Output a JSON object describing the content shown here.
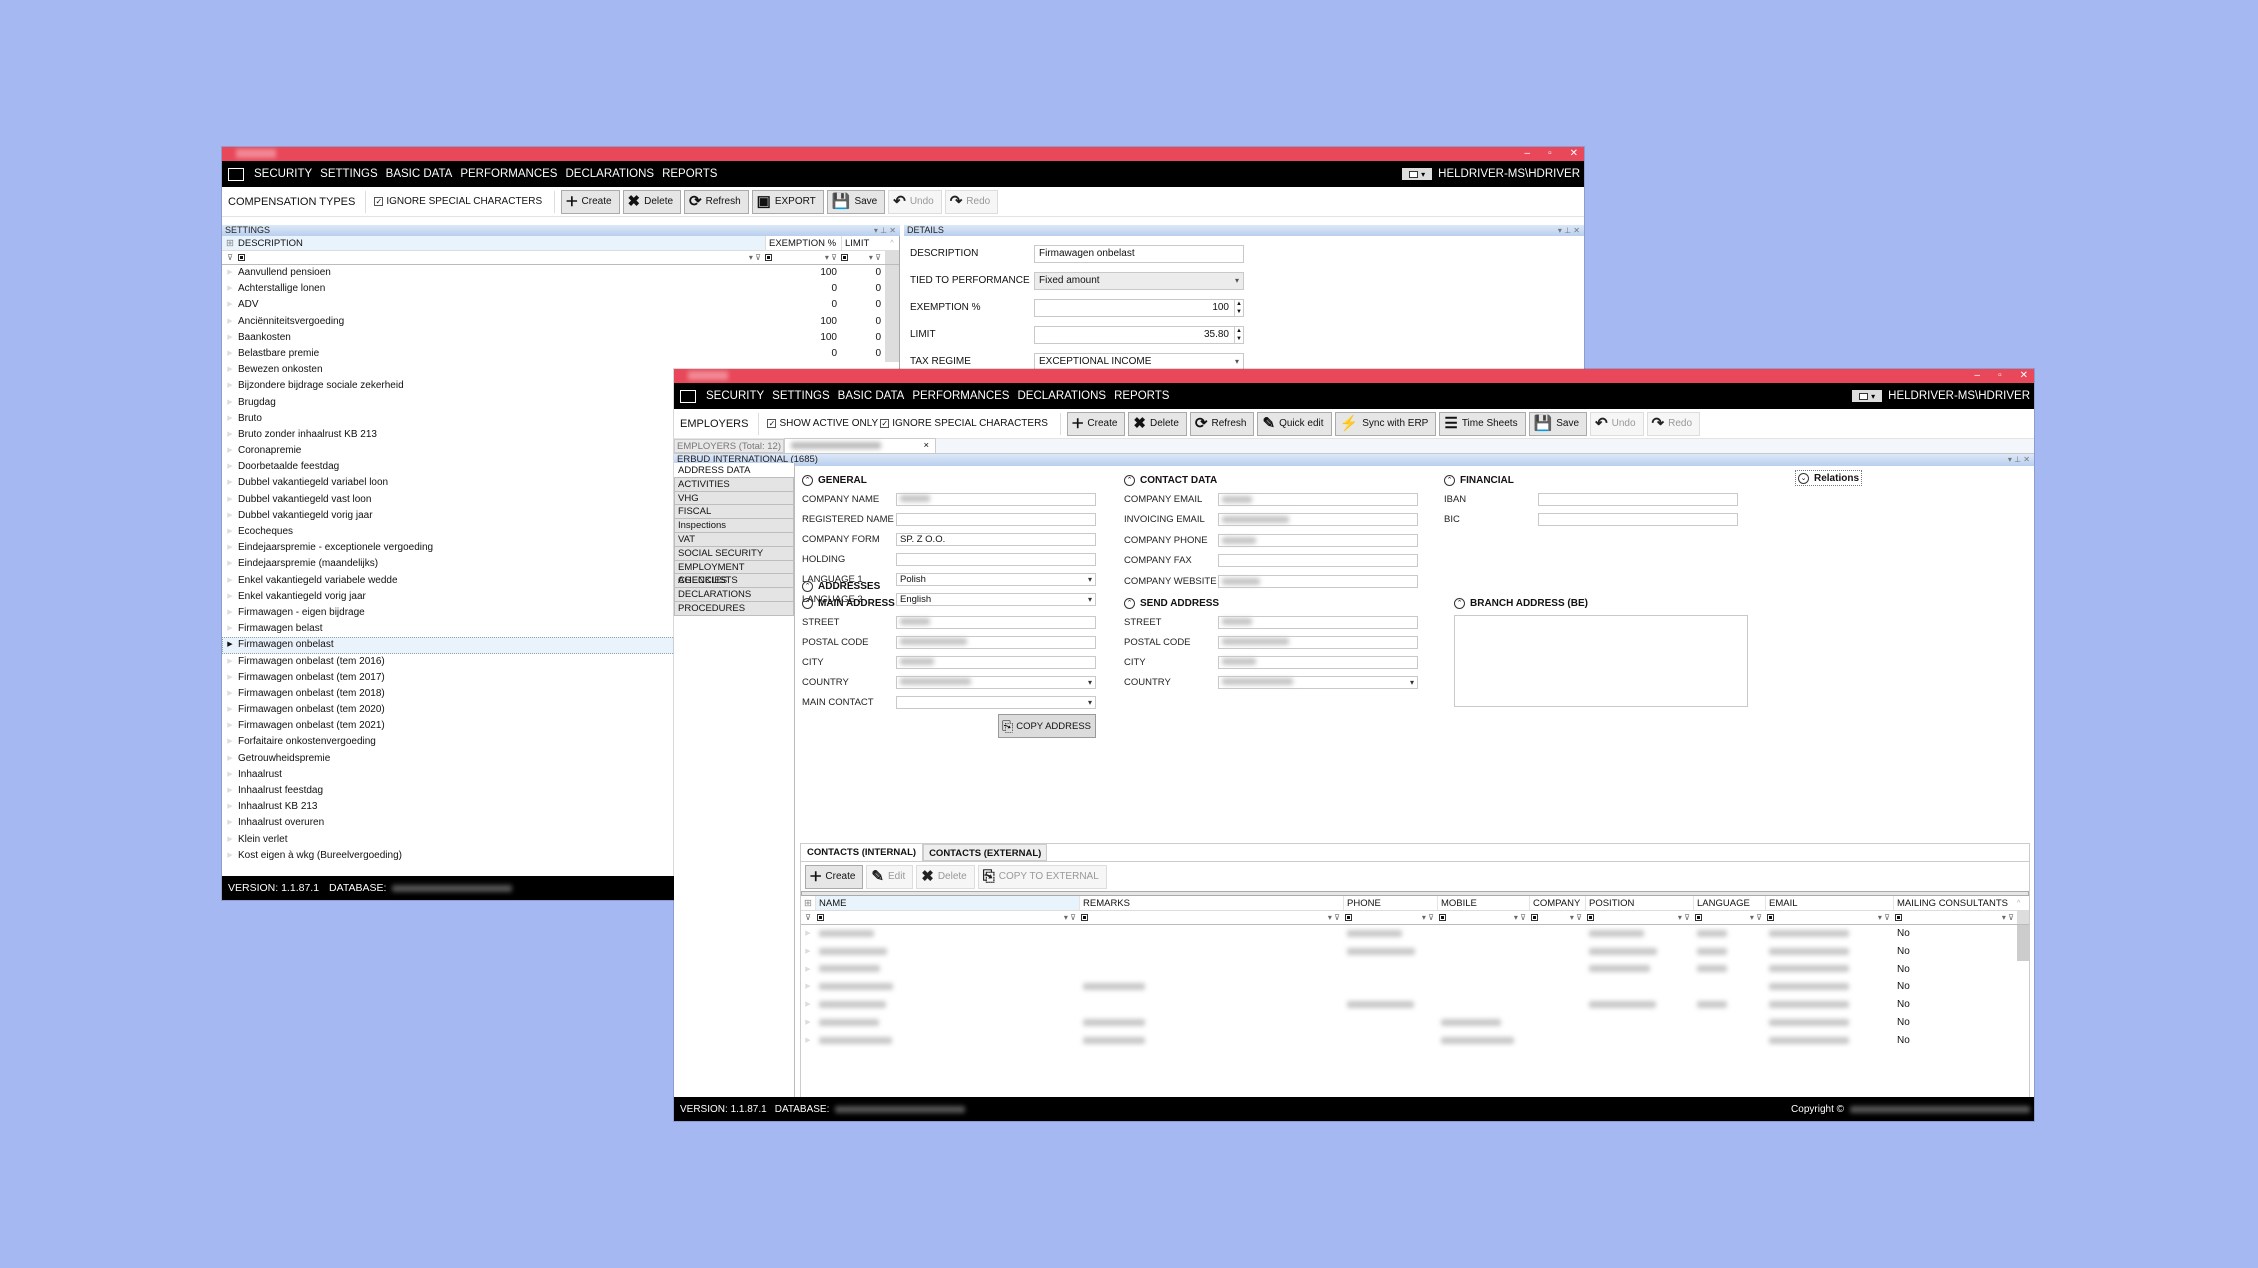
{
  "colors": {
    "titlebar": "#e8485a",
    "menubar": "#000000",
    "panel_header": "#c6d8f0",
    "background": "#a6b8f2"
  },
  "menu": [
    "SECURITY",
    "SETTINGS",
    "BASIC DATA",
    "PERFORMANCES",
    "DECLARATIONS",
    "REPORTS"
  ],
  "user": "HELDRIVER-MS\\HDRIVER",
  "window_controls": {
    "minimize": "–",
    "maximize": "▫",
    "close": "✕"
  },
  "comp_window": {
    "toolbar": {
      "title": "COMPENSATION TYPES",
      "ignore_special_label": "IGNORE SPECIAL CHARACTERS",
      "ignore_special_checked": true,
      "buttons": [
        {
          "label": "Create",
          "icon": "create-icon",
          "enabled": true
        },
        {
          "label": "Delete",
          "icon": "delete-icon",
          "enabled": true
        },
        {
          "label": "Refresh",
          "icon": "refresh-icon",
          "enabled": true
        },
        {
          "label": "EXPORT",
          "icon": "export-icon",
          "enabled": true
        },
        {
          "label": "Save",
          "icon": "save-icon",
          "enabled": true
        },
        {
          "label": "Undo",
          "icon": "undo-icon",
          "enabled": false
        },
        {
          "label": "Redo",
          "icon": "redo-icon",
          "enabled": false
        }
      ]
    },
    "settings_panel": {
      "title": "SETTINGS",
      "columns": [
        "DESCRIPTION",
        "EXEMPTION %",
        "LIMIT"
      ],
      "rows": [
        {
          "description": "Aanvullend pensioen",
          "exemption": "100",
          "limit": "0"
        },
        {
          "description": "Achterstallige lonen",
          "exemption": "0",
          "limit": "0"
        },
        {
          "description": "ADV",
          "exemption": "0",
          "limit": "0"
        },
        {
          "description": "Anciënniteitsvergoeding",
          "exemption": "100",
          "limit": "0"
        },
        {
          "description": "Baankosten",
          "exemption": "100",
          "limit": "0"
        },
        {
          "description": "Belastbare premie",
          "exemption": "0",
          "limit": "0"
        },
        {
          "description": "Bewezen onkosten",
          "exemption": "",
          "limit": ""
        },
        {
          "description": "Bijzondere bijdrage sociale zekerheid",
          "exemption": "",
          "limit": ""
        },
        {
          "description": "Brugdag",
          "exemption": "",
          "limit": ""
        },
        {
          "description": "Bruto",
          "exemption": "",
          "limit": ""
        },
        {
          "description": "Bruto zonder inhaalrust KB 213",
          "exemption": "",
          "limit": ""
        },
        {
          "description": "Coronapremie",
          "exemption": "",
          "limit": ""
        },
        {
          "description": "Doorbetaalde feestdag",
          "exemption": "",
          "limit": ""
        },
        {
          "description": "Dubbel vakantiegeld variabel loon",
          "exemption": "",
          "limit": ""
        },
        {
          "description": "Dubbel vakantiegeld vast loon",
          "exemption": "",
          "limit": ""
        },
        {
          "description": "Dubbel vakantiegeld vorig jaar",
          "exemption": "",
          "limit": ""
        },
        {
          "description": "Ecocheques",
          "exemption": "",
          "limit": ""
        },
        {
          "description": "Eindejaarspremie - exceptionele vergoeding",
          "exemption": "",
          "limit": ""
        },
        {
          "description": "Eindejaarspremie (maandelijks)",
          "exemption": "",
          "limit": ""
        },
        {
          "description": "Enkel vakantiegeld variabele wedde",
          "exemption": "",
          "limit": ""
        },
        {
          "description": "Enkel vakantiegeld vorig jaar",
          "exemption": "",
          "limit": ""
        },
        {
          "description": "Firmawagen - eigen bijdrage",
          "exemption": "",
          "limit": ""
        },
        {
          "description": "Firmawagen belast",
          "exemption": "",
          "limit": ""
        },
        {
          "description": "Firmawagen onbelast",
          "exemption": "",
          "limit": "",
          "selected": true
        },
        {
          "description": "Firmawagen onbelast (tem 2016)",
          "exemption": "",
          "limit": ""
        },
        {
          "description": "Firmawagen onbelast (tem 2017)",
          "exemption": "",
          "limit": ""
        },
        {
          "description": "Firmawagen onbelast (tem 2018)",
          "exemption": "",
          "limit": ""
        },
        {
          "description": "Firmawagen onbelast (tem 2020)",
          "exemption": "",
          "limit": ""
        },
        {
          "description": "Firmawagen onbelast (tem 2021)",
          "exemption": "",
          "limit": ""
        },
        {
          "description": "Forfaitaire onkostenvergoeding",
          "exemption": "",
          "limit": ""
        },
        {
          "description": "Getrouwheidspremie",
          "exemption": "",
          "limit": ""
        },
        {
          "description": "Inhaalrust",
          "exemption": "",
          "limit": ""
        },
        {
          "description": "Inhaalrust feestdag",
          "exemption": "",
          "limit": ""
        },
        {
          "description": "Inhaalrust KB 213",
          "exemption": "",
          "limit": ""
        },
        {
          "description": "Inhaalrust overuren",
          "exemption": "",
          "limit": ""
        },
        {
          "description": "Klein verlet",
          "exemption": "",
          "limit": ""
        },
        {
          "description": "Kost eigen à wkg (Bureelvergoeding)",
          "exemption": "",
          "limit": ""
        }
      ]
    },
    "details_panel": {
      "title": "DETAILS",
      "fields": [
        {
          "label": "DESCRIPTION",
          "value": "Firmawagen onbelast",
          "type": "text"
        },
        {
          "label": "TIED TO PERFORMANCE",
          "value": "Fixed amount",
          "type": "select"
        },
        {
          "label": "EXEMPTION %",
          "value": "100",
          "type": "spinner"
        },
        {
          "label": "LIMIT",
          "value": "35.80",
          "type": "spinner"
        },
        {
          "label": "TAX REGIME",
          "value": "EXCEPTIONAL INCOME",
          "type": "select"
        }
      ]
    },
    "status": {
      "version": "VERSION: 1.1.87.1",
      "database_label": "DATABASE:"
    }
  },
  "emp_window": {
    "toolbar": {
      "title": "EMPLOYERS",
      "show_active_label": "SHOW ACTIVE ONLY",
      "show_active_checked": true,
      "ignore_special_label": "IGNORE SPECIAL CHARACTERS",
      "ignore_special_checked": true,
      "buttons": [
        {
          "label": "Create",
          "icon": "create-icon",
          "enabled": true
        },
        {
          "label": "Delete",
          "icon": "delete-icon",
          "enabled": true
        },
        {
          "label": "Refresh",
          "icon": "refresh-icon",
          "enabled": true
        },
        {
          "label": "Quick edit",
          "icon": "edit-icon",
          "enabled": true
        },
        {
          "label": "Sync with ERP",
          "icon": "plug-icon",
          "enabled": true
        },
        {
          "label": "Time Sheets",
          "icon": "list-icon",
          "enabled": true
        },
        {
          "label": "Save",
          "icon": "save-icon",
          "enabled": true
        },
        {
          "label": "Undo",
          "icon": "undo-icon",
          "enabled": false
        },
        {
          "label": "Redo",
          "icon": "redo-icon",
          "enabled": false
        }
      ]
    },
    "doc_tabs": [
      {
        "label": "EMPLOYERS (Total: 12)",
        "active": false
      },
      {
        "label": "",
        "active": true,
        "blurred": true,
        "close": "×"
      }
    ],
    "panel_title": "ERBUD INTERNATIONAL (1685)",
    "nav_tabs": [
      "ADDRESS DATA",
      "ACTIVITIES",
      "VHG",
      "FISCAL",
      "Inspections",
      "VAT",
      "SOCIAL SECURITY",
      "EMPLOYMENT AGENCIES",
      "CHECKLISTS",
      "DECLARATIONS",
      "PROCEDURES"
    ],
    "general": {
      "title": "GENERAL",
      "fields": [
        {
          "label": "COMPANY NAME",
          "value": "",
          "blurred": true
        },
        {
          "label": "REGISTERED NAME",
          "value": ""
        },
        {
          "label": "COMPANY FORM",
          "value": "SP. Z O.O."
        },
        {
          "label": "HOLDING",
          "value": ""
        },
        {
          "label": "LANGUAGE 1",
          "value": "Polish",
          "select": true
        },
        {
          "label": "LANGUAGE 2",
          "value": "English",
          "select": true
        }
      ]
    },
    "contact": {
      "title": "CONTACT DATA",
      "fields": [
        {
          "label": "COMPANY EMAIL",
          "value": "",
          "blurred": true
        },
        {
          "label": "INVOICING EMAIL",
          "value": "",
          "blurred": true
        },
        {
          "label": "COMPANY PHONE",
          "value": "",
          "blurred": true
        },
        {
          "label": "COMPANY FAX",
          "value": ""
        },
        {
          "label": "COMPANY WEBSITE",
          "value": "",
          "blurred": true
        }
      ]
    },
    "financial": {
      "title": "FINANCIAL",
      "fields": [
        {
          "label": "IBAN",
          "value": ""
        },
        {
          "label": "BIC",
          "value": ""
        }
      ]
    },
    "relations": {
      "title": "Relations"
    },
    "addresses": {
      "title": "ADDRESSES",
      "main": {
        "title": "MAIN ADDRESS",
        "fields": [
          {
            "label": "STREET",
            "blurred": true
          },
          {
            "label": "POSTAL CODE",
            "blurred": true
          },
          {
            "label": "CITY",
            "blurred": true
          },
          {
            "label": "COUNTRY",
            "blurred": true,
            "select": true
          },
          {
            "label": "MAIN CONTACT",
            "select": true
          }
        ],
        "copy_label": "COPY ADDRESS"
      },
      "send": {
        "title": "SEND ADDRESS",
        "fields": [
          {
            "label": "STREET",
            "blurred": true
          },
          {
            "label": "POSTAL CODE",
            "blurred": true
          },
          {
            "label": "CITY",
            "blurred": true
          },
          {
            "label": "COUNTRY",
            "blurred": true,
            "select": true
          }
        ]
      },
      "branch": {
        "title": "BRANCH ADDRESS (BE)"
      }
    },
    "contacts": {
      "tabs": [
        "CONTACTS (INTERNAL)",
        "CONTACTS (EXTERNAL)"
      ],
      "buttons": [
        {
          "label": "Create",
          "icon": "create-icon",
          "enabled": true
        },
        {
          "label": "Edit",
          "icon": "edit-icon",
          "enabled": false
        },
        {
          "label": "Delete",
          "icon": "delete-icon",
          "enabled": false
        },
        {
          "label": "COPY TO EXTERNAL",
          "icon": "copy-icon",
          "enabled": false
        }
      ],
      "columns": [
        "NAME",
        "REMARKS",
        "PHONE",
        "MOBILE",
        "COMPANY",
        "POSITION",
        "LANGUAGE",
        "EMAIL",
        "MAILING CONSULTANTS"
      ],
      "rows": [
        {
          "name": true,
          "remarks": false,
          "phone": true,
          "mobile": false,
          "position": true,
          "language": true,
          "email": true,
          "mailing": "No"
        },
        {
          "name": true,
          "remarks": false,
          "phone": true,
          "mobile": false,
          "position": true,
          "language": true,
          "email": true,
          "mailing": "No"
        },
        {
          "name": true,
          "remarks": false,
          "phone": false,
          "mobile": false,
          "position": true,
          "language": true,
          "email": true,
          "mailing": "No"
        },
        {
          "name": true,
          "remarks": true,
          "phone": false,
          "mobile": false,
          "position": false,
          "language": false,
          "email": true,
          "mailing": "No"
        },
        {
          "name": true,
          "remarks": false,
          "phone": true,
          "mobile": false,
          "position": true,
          "language": true,
          "email": true,
          "mailing": "No"
        },
        {
          "name": true,
          "remarks": true,
          "phone": false,
          "mobile": true,
          "position": false,
          "language": false,
          "email": true,
          "mailing": "No"
        },
        {
          "name": true,
          "remarks": true,
          "phone": false,
          "mobile": true,
          "position": false,
          "language": false,
          "email": true,
          "mailing": "No"
        }
      ]
    },
    "status": {
      "version": "VERSION: 1.1.87.1",
      "database_label": "DATABASE:",
      "copyright": "Copyright ©"
    }
  }
}
